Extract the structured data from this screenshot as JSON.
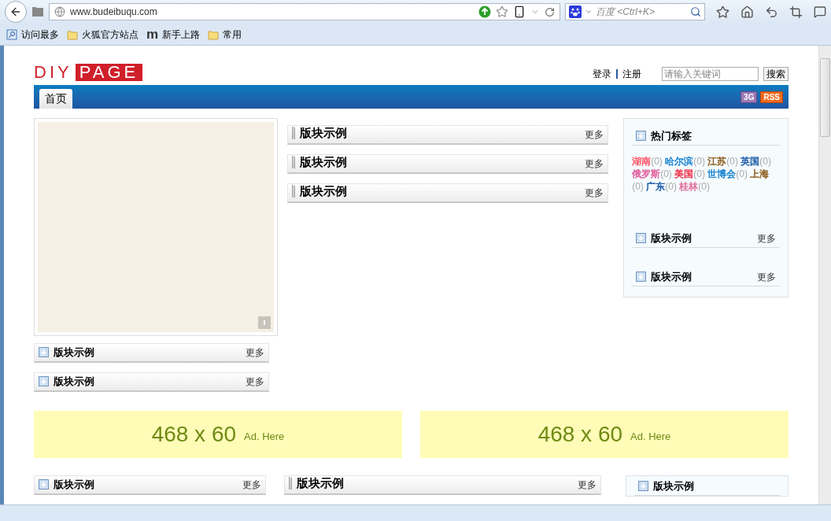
{
  "browser": {
    "url": "www.budeibuqu.com",
    "search_placeholder": "百度 <Ctrl+K>",
    "bookmarks": [
      {
        "label": "访问最多",
        "kind": "search"
      },
      {
        "label": "火狐官方站点",
        "kind": "folder"
      },
      {
        "label": "新手上路",
        "kind": "letter",
        "icon_text": "m"
      },
      {
        "label": "常用",
        "kind": "folder"
      }
    ]
  },
  "header": {
    "logo": [
      "DIY",
      "PAGE"
    ],
    "links": [
      "登录",
      "注册"
    ],
    "search": {
      "placeholder": "请输入关键词",
      "button": "搜索"
    }
  },
  "nav": {
    "tabs": [
      {
        "label": "首页",
        "selected": true
      }
    ],
    "badges": [
      {
        "label": "3G",
        "kind": "mobile"
      },
      {
        "label": "RSS",
        "kind": "rss"
      }
    ]
  },
  "left_blocks": [
    {
      "title": "版块示例",
      "more": "更多",
      "kind": "arrow"
    },
    {
      "title": "版块示例",
      "more": "更多",
      "kind": "arrow"
    }
  ],
  "middle_blocks": [
    {
      "title": "版块示例",
      "more": "更多",
      "kind": "grip"
    },
    {
      "title": "版块示例",
      "more": "更多",
      "kind": "grip"
    },
    {
      "title": "版块示例",
      "more": "更多",
      "kind": "grip"
    }
  ],
  "sidebar": {
    "tags_title": "热门标签",
    "tags": [
      {
        "name": "湖南",
        "count": "(0)",
        "color": "#ff5a6a"
      },
      {
        "name": "哈尔滨",
        "count": "(0)",
        "color": "#1a84d0"
      },
      {
        "name": "江苏",
        "count": "(0)",
        "color": "#8a5a1a"
      },
      {
        "name": "英国",
        "count": "(0)",
        "color": "#1a5aa8"
      },
      {
        "name": "俄罗斯",
        "count": "(0)",
        "color": "#e05a9a"
      },
      {
        "name": "美国",
        "count": "(0)",
        "color": "#f0304a"
      },
      {
        "name": "世博会",
        "count": "(0)",
        "color": "#1a84d0"
      },
      {
        "name": "上海",
        "count": "(0)",
        "color": "#8a5a1a"
      },
      {
        "name": "广东",
        "count": "(0)",
        "color": "#1a5aa8"
      },
      {
        "name": "桂林",
        "count": "(0)",
        "color": "#e070a0"
      }
    ],
    "blocks": [
      {
        "title": "版块示例",
        "more": "更多"
      },
      {
        "title": "版块示例",
        "more": "更多"
      }
    ]
  },
  "ads": [
    {
      "size": "468 x 60",
      "caption": "Ad. Here"
    },
    {
      "size": "468 x 60",
      "caption": "Ad. Here"
    }
  ],
  "bottom_blocks": [
    {
      "title": "版块示例",
      "more": "更多",
      "kind": "arrow"
    },
    {
      "title": "版块示例",
      "more": "更多",
      "kind": "grip"
    },
    {
      "title": "版块示例",
      "kind": "arrow"
    }
  ]
}
